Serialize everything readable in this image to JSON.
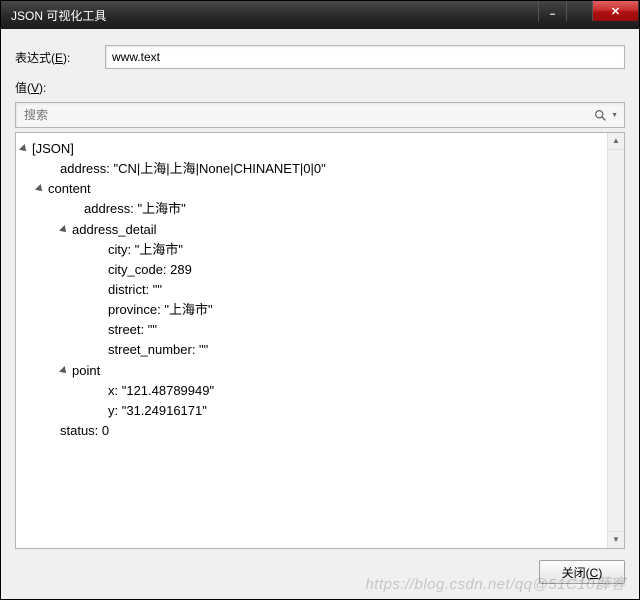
{
  "window": {
    "title": "JSON 可视化工具"
  },
  "labels": {
    "expression_prefix": "表达式(",
    "expression_hotkey": "E",
    "expression_suffix": "):",
    "value_prefix": "值(",
    "value_hotkey": "V",
    "value_suffix": "):",
    "close_prefix": "关闭(",
    "close_hotkey": "C",
    "close_suffix": ")"
  },
  "expression": {
    "value": "www.text"
  },
  "search": {
    "placeholder": "搜索"
  },
  "tree": {
    "root": "[JSON]",
    "address": "address: \"CN|上海|上海|None|CHINANET|0|0\"",
    "content": "content",
    "content_address": "address: \"上海市\"",
    "address_detail": "address_detail",
    "ad_city": "city: \"上海市\"",
    "ad_city_code": "city_code: 289",
    "ad_district": "district: \"\"",
    "ad_province": "province: \"上海市\"",
    "ad_street": "street: \"\"",
    "ad_street_number": "street_number: \"\"",
    "point": "point",
    "pt_x": "x: \"121.48789949\"",
    "pt_y": "y: \"31.24916171\"",
    "status": "status: 0"
  },
  "watermark": "https://blog.csdn.net/qq@51C10薜客"
}
